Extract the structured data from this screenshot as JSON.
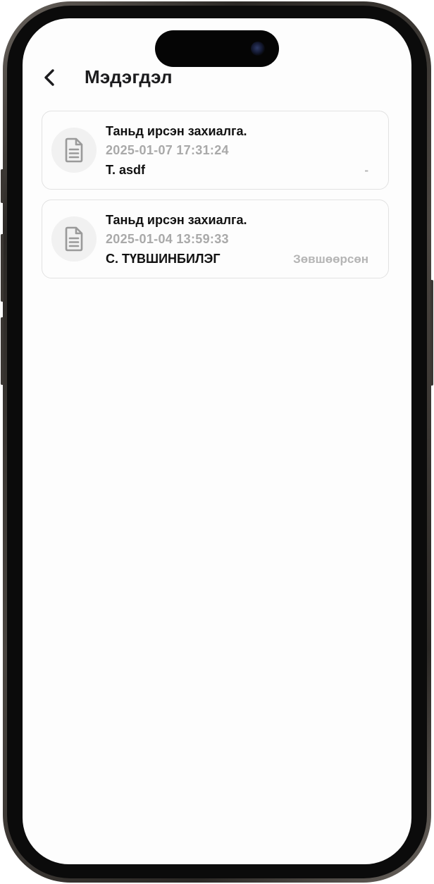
{
  "header": {
    "title": "Мэдэгдэл",
    "back_icon": "chevron-left-icon"
  },
  "notifications": [
    {
      "icon": "document-icon",
      "title": "Таньд ирсэн захиалга.",
      "datetime": "2025-01-07 17:31:24",
      "name": "T. asdf",
      "status": "-"
    },
    {
      "icon": "document-icon",
      "title": "Таньд ирсэн захиалга.",
      "datetime": "2025-01-04 13:59:33",
      "name": "С. ТҮВШИНБИЛЭГ",
      "status": "Зөвшөөрсөн"
    }
  ],
  "colors": {
    "title_text": "#111111",
    "muted_text": "#a9a9a9",
    "status_text": "#b5b5b5",
    "card_border": "#e2e2e2",
    "icon_bg": "#f1f1f1"
  }
}
